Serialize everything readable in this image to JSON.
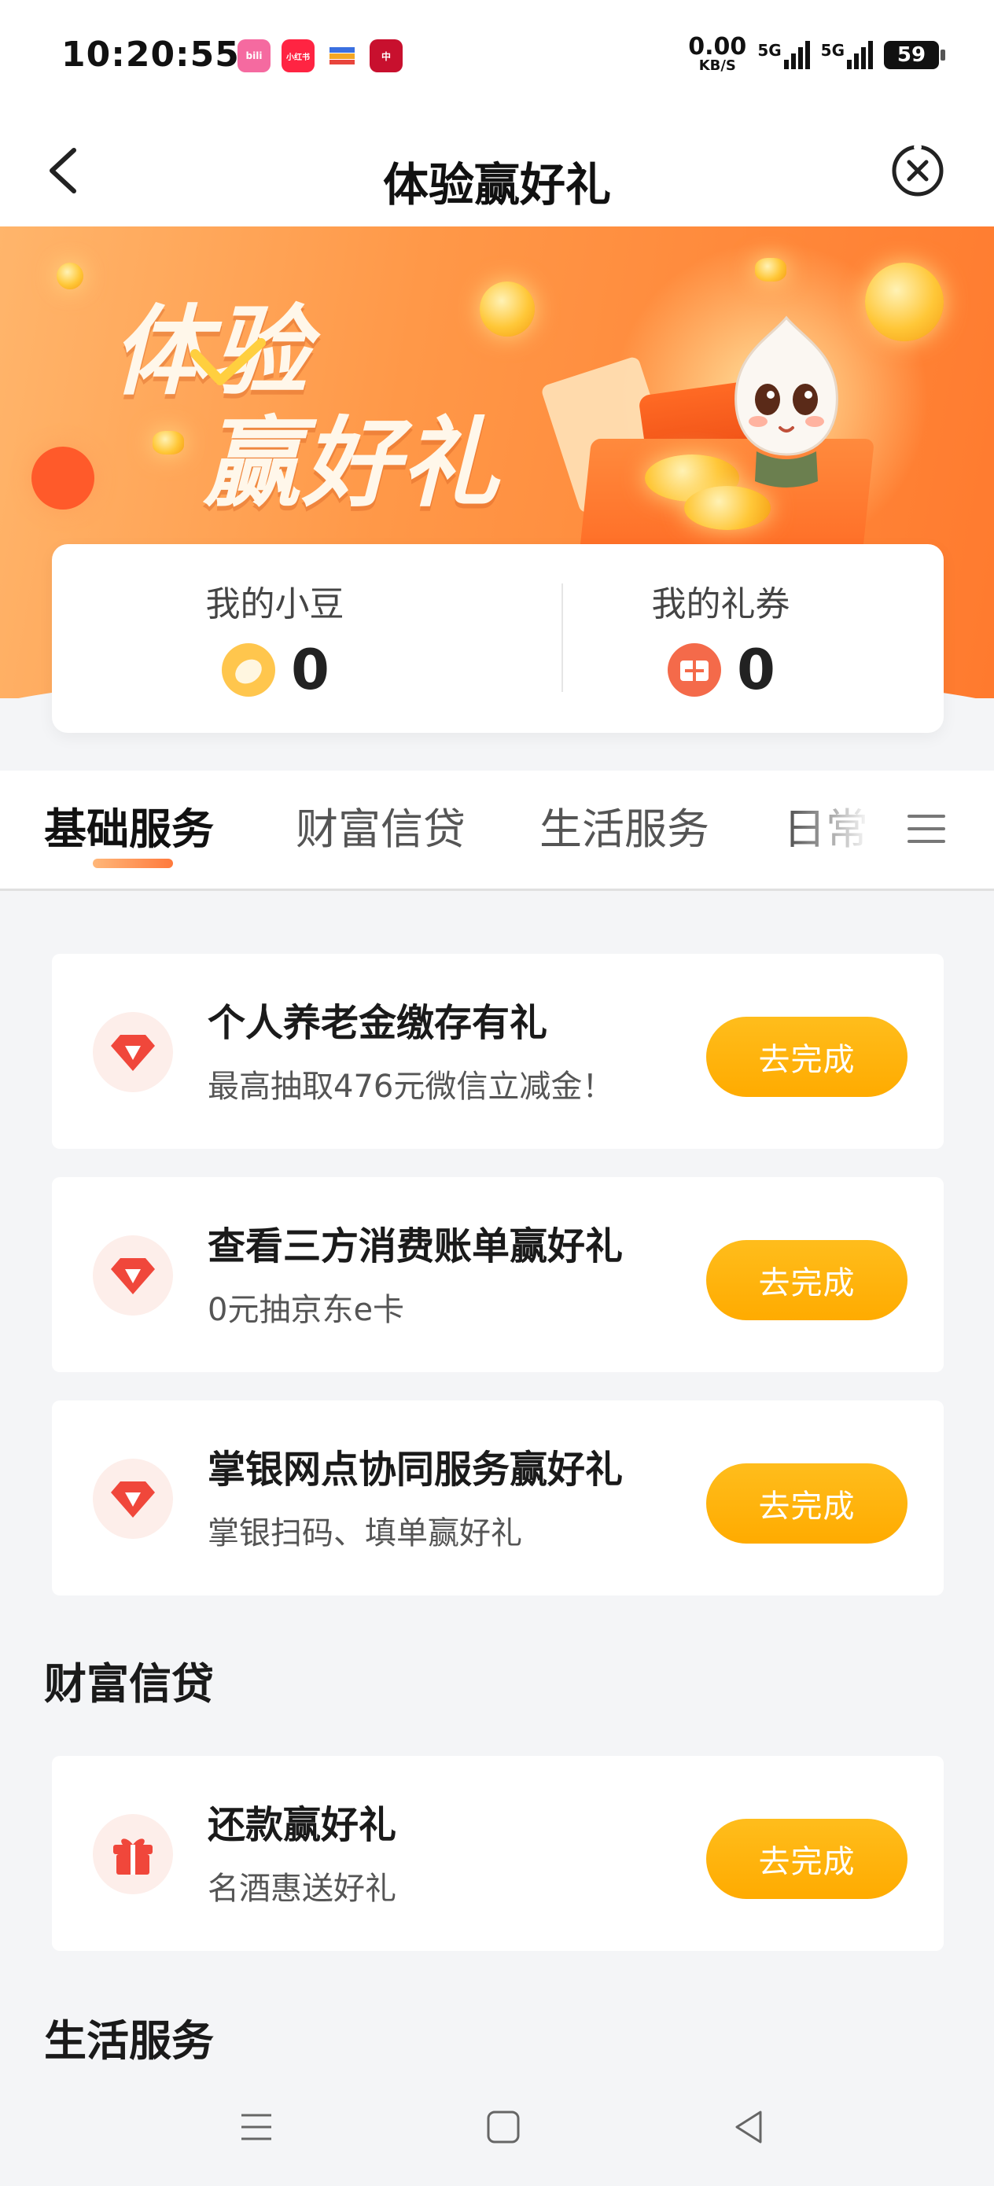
{
  "status_bar": {
    "time": "10:20:55",
    "apps": [
      {
        "name": "bilibili",
        "label": "bili",
        "color": "#f56aa0"
      },
      {
        "name": "xiaohongshu",
        "label": "小红书",
        "color": "#ff2442"
      },
      {
        "name": "wallet",
        "label": "",
        "color": "#3a6fe0"
      },
      {
        "name": "boc",
        "label": "中",
        "color": "#c8102e"
      }
    ],
    "net_speed_value": "0.00",
    "net_speed_unit": "KB/S",
    "signal1": "5G",
    "signal2": "5G",
    "battery": "59"
  },
  "nav": {
    "title": "体验赢好礼"
  },
  "banner": {
    "title_line1": "体验",
    "title_line2": "赢好礼"
  },
  "points": {
    "beans_label": "我的小豆",
    "beans_value": "0",
    "coupons_label": "我的礼券",
    "coupons_value": "0"
  },
  "tabs": [
    {
      "label": "基础服务",
      "active": true
    },
    {
      "label": "财富信贷",
      "active": false
    },
    {
      "label": "生活服务",
      "active": false
    },
    {
      "label": "日常",
      "active": false
    }
  ],
  "basic_tasks": [
    {
      "title": "个人养老金缴存有礼",
      "subtitle": "最高抽取476元微信立减金！",
      "button": "去完成",
      "icon": "diamond-icon"
    },
    {
      "title": "查看三方消费账单赢好礼",
      "subtitle": "0元抽京东e卡",
      "button": "去完成",
      "icon": "diamond-icon"
    },
    {
      "title": "掌银网点协同服务赢好礼",
      "subtitle": "掌银扫码、填单赢好礼",
      "button": "去完成",
      "icon": "diamond-icon"
    }
  ],
  "sections": {
    "wealth_credit": "财富信贷",
    "life_service": "生活服务"
  },
  "wealth_tasks": [
    {
      "title": "还款赢好礼",
      "subtitle": "名酒惠送好礼",
      "button": "去完成",
      "icon": "gift-icon"
    }
  ],
  "colors": {
    "accent_orange": "#ff7a2e",
    "button_yellow": "#ffab00",
    "icon_red": "#f0473b"
  }
}
